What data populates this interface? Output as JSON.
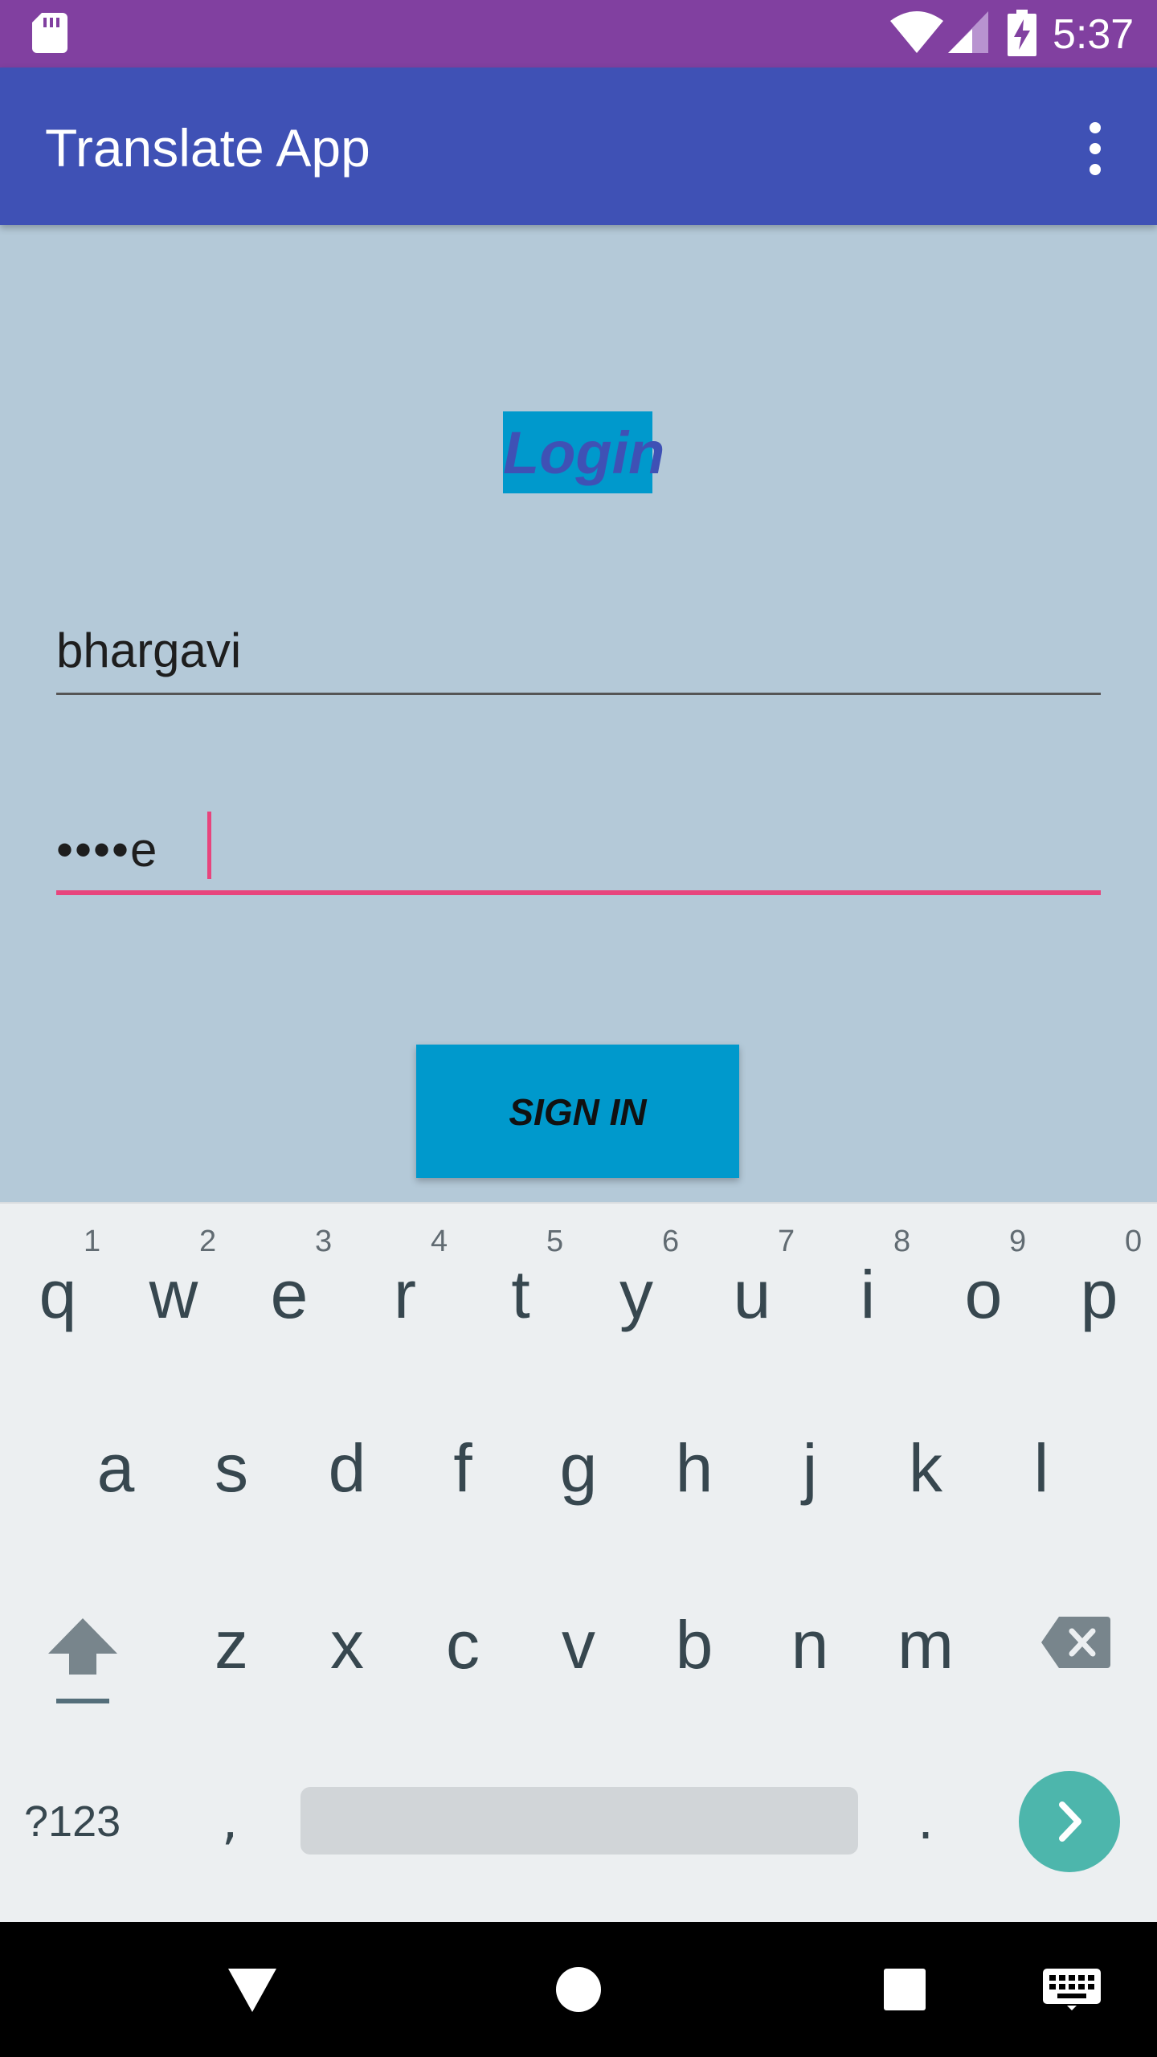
{
  "status_bar": {
    "time": "5:37",
    "icons": [
      "sd-card-icon",
      "wifi-icon",
      "signal-icon",
      "battery-charging-icon"
    ],
    "background": "#8140a0"
  },
  "app_bar": {
    "title": "Translate App",
    "menu_icon": "more-vert-icon",
    "background": "#3f51b5"
  },
  "login": {
    "heading": "Login",
    "username_value": "bhargavi",
    "password_value": "••••e",
    "sign_in_label": "SIGN IN",
    "accent": "#e8447d",
    "button_color": "#0099cc"
  },
  "keyboard": {
    "row1": [
      {
        "key": "q",
        "hint": "1"
      },
      {
        "key": "w",
        "hint": "2"
      },
      {
        "key": "e",
        "hint": "3"
      },
      {
        "key": "r",
        "hint": "4"
      },
      {
        "key": "t",
        "hint": "5"
      },
      {
        "key": "y",
        "hint": "6"
      },
      {
        "key": "u",
        "hint": "7"
      },
      {
        "key": "i",
        "hint": "8"
      },
      {
        "key": "o",
        "hint": "9"
      },
      {
        "key": "p",
        "hint": "0"
      }
    ],
    "row2": [
      "a",
      "s",
      "d",
      "f",
      "g",
      "h",
      "j",
      "k",
      "l"
    ],
    "row3": [
      "z",
      "x",
      "c",
      "v",
      "b",
      "n",
      "m"
    ],
    "symbols_label": "?123",
    "comma_label": ",",
    "period_label": ".",
    "icons": [
      "shift-icon",
      "backspace-icon",
      "enter-arrow-icon"
    ],
    "enter_color": "#4db6ac"
  },
  "nav_bar": {
    "icons": [
      "back-icon",
      "home-icon",
      "recents-icon",
      "keyboard-switch-icon"
    ]
  }
}
